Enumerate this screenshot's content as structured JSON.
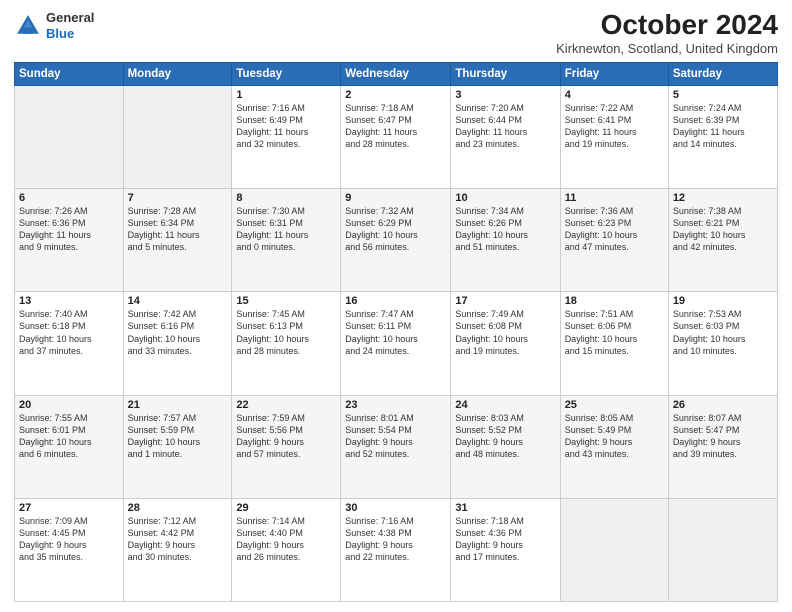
{
  "header": {
    "logo_general": "General",
    "logo_blue": "Blue",
    "month_title": "October 2024",
    "location": "Kirknewton, Scotland, United Kingdom"
  },
  "weekdays": [
    "Sunday",
    "Monday",
    "Tuesday",
    "Wednesday",
    "Thursday",
    "Friday",
    "Saturday"
  ],
  "weeks": [
    [
      {
        "day": "",
        "content": ""
      },
      {
        "day": "",
        "content": ""
      },
      {
        "day": "1",
        "content": "Sunrise: 7:16 AM\nSunset: 6:49 PM\nDaylight: 11 hours\nand 32 minutes."
      },
      {
        "day": "2",
        "content": "Sunrise: 7:18 AM\nSunset: 6:47 PM\nDaylight: 11 hours\nand 28 minutes."
      },
      {
        "day": "3",
        "content": "Sunrise: 7:20 AM\nSunset: 6:44 PM\nDaylight: 11 hours\nand 23 minutes."
      },
      {
        "day": "4",
        "content": "Sunrise: 7:22 AM\nSunset: 6:41 PM\nDaylight: 11 hours\nand 19 minutes."
      },
      {
        "day": "5",
        "content": "Sunrise: 7:24 AM\nSunset: 6:39 PM\nDaylight: 11 hours\nand 14 minutes."
      }
    ],
    [
      {
        "day": "6",
        "content": "Sunrise: 7:26 AM\nSunset: 6:36 PM\nDaylight: 11 hours\nand 9 minutes."
      },
      {
        "day": "7",
        "content": "Sunrise: 7:28 AM\nSunset: 6:34 PM\nDaylight: 11 hours\nand 5 minutes."
      },
      {
        "day": "8",
        "content": "Sunrise: 7:30 AM\nSunset: 6:31 PM\nDaylight: 11 hours\nand 0 minutes."
      },
      {
        "day": "9",
        "content": "Sunrise: 7:32 AM\nSunset: 6:29 PM\nDaylight: 10 hours\nand 56 minutes."
      },
      {
        "day": "10",
        "content": "Sunrise: 7:34 AM\nSunset: 6:26 PM\nDaylight: 10 hours\nand 51 minutes."
      },
      {
        "day": "11",
        "content": "Sunrise: 7:36 AM\nSunset: 6:23 PM\nDaylight: 10 hours\nand 47 minutes."
      },
      {
        "day": "12",
        "content": "Sunrise: 7:38 AM\nSunset: 6:21 PM\nDaylight: 10 hours\nand 42 minutes."
      }
    ],
    [
      {
        "day": "13",
        "content": "Sunrise: 7:40 AM\nSunset: 6:18 PM\nDaylight: 10 hours\nand 37 minutes."
      },
      {
        "day": "14",
        "content": "Sunrise: 7:42 AM\nSunset: 6:16 PM\nDaylight: 10 hours\nand 33 minutes."
      },
      {
        "day": "15",
        "content": "Sunrise: 7:45 AM\nSunset: 6:13 PM\nDaylight: 10 hours\nand 28 minutes."
      },
      {
        "day": "16",
        "content": "Sunrise: 7:47 AM\nSunset: 6:11 PM\nDaylight: 10 hours\nand 24 minutes."
      },
      {
        "day": "17",
        "content": "Sunrise: 7:49 AM\nSunset: 6:08 PM\nDaylight: 10 hours\nand 19 minutes."
      },
      {
        "day": "18",
        "content": "Sunrise: 7:51 AM\nSunset: 6:06 PM\nDaylight: 10 hours\nand 15 minutes."
      },
      {
        "day": "19",
        "content": "Sunrise: 7:53 AM\nSunset: 6:03 PM\nDaylight: 10 hours\nand 10 minutes."
      }
    ],
    [
      {
        "day": "20",
        "content": "Sunrise: 7:55 AM\nSunset: 6:01 PM\nDaylight: 10 hours\nand 6 minutes."
      },
      {
        "day": "21",
        "content": "Sunrise: 7:57 AM\nSunset: 5:59 PM\nDaylight: 10 hours\nand 1 minute."
      },
      {
        "day": "22",
        "content": "Sunrise: 7:59 AM\nSunset: 5:56 PM\nDaylight: 9 hours\nand 57 minutes."
      },
      {
        "day": "23",
        "content": "Sunrise: 8:01 AM\nSunset: 5:54 PM\nDaylight: 9 hours\nand 52 minutes."
      },
      {
        "day": "24",
        "content": "Sunrise: 8:03 AM\nSunset: 5:52 PM\nDaylight: 9 hours\nand 48 minutes."
      },
      {
        "day": "25",
        "content": "Sunrise: 8:05 AM\nSunset: 5:49 PM\nDaylight: 9 hours\nand 43 minutes."
      },
      {
        "day": "26",
        "content": "Sunrise: 8:07 AM\nSunset: 5:47 PM\nDaylight: 9 hours\nand 39 minutes."
      }
    ],
    [
      {
        "day": "27",
        "content": "Sunrise: 7:09 AM\nSunset: 4:45 PM\nDaylight: 9 hours\nand 35 minutes."
      },
      {
        "day": "28",
        "content": "Sunrise: 7:12 AM\nSunset: 4:42 PM\nDaylight: 9 hours\nand 30 minutes."
      },
      {
        "day": "29",
        "content": "Sunrise: 7:14 AM\nSunset: 4:40 PM\nDaylight: 9 hours\nand 26 minutes."
      },
      {
        "day": "30",
        "content": "Sunrise: 7:16 AM\nSunset: 4:38 PM\nDaylight: 9 hours\nand 22 minutes."
      },
      {
        "day": "31",
        "content": "Sunrise: 7:18 AM\nSunset: 4:36 PM\nDaylight: 9 hours\nand 17 minutes."
      },
      {
        "day": "",
        "content": ""
      },
      {
        "day": "",
        "content": ""
      }
    ]
  ]
}
